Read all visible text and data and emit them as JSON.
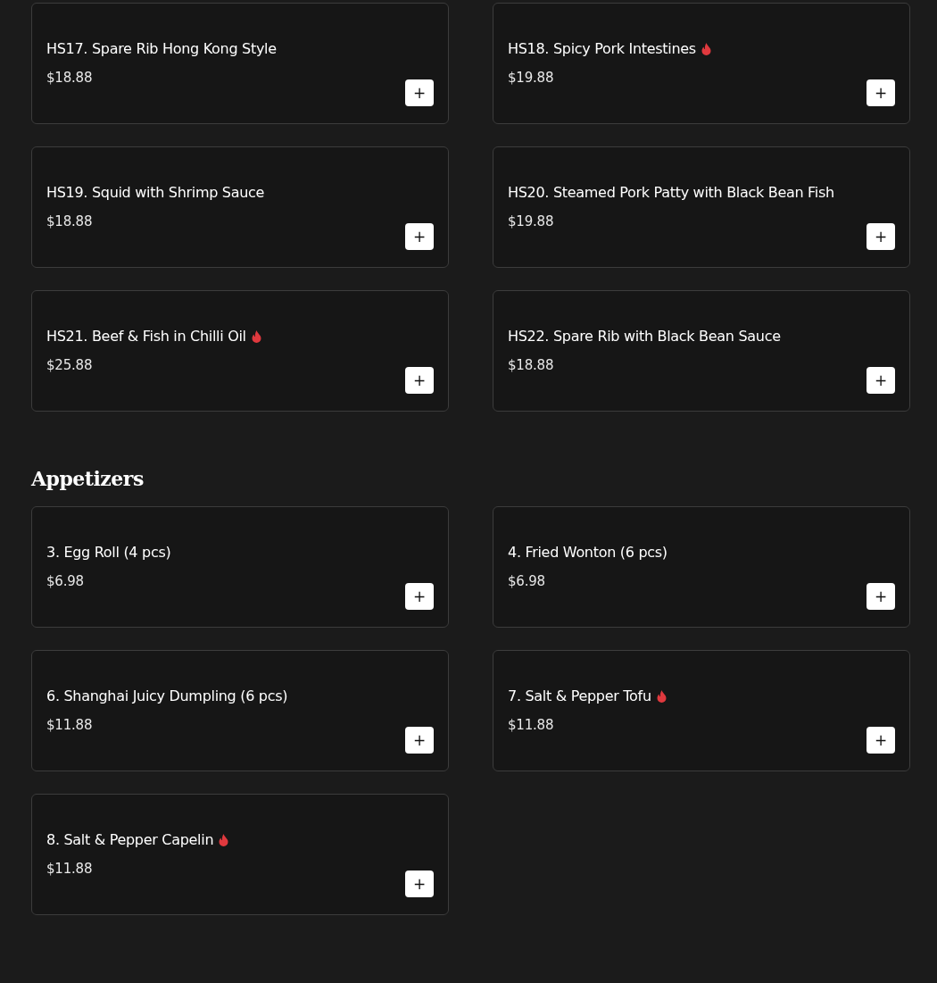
{
  "sections": [
    {
      "items": [
        {
          "name": "HS17. Spare Rib Hong Kong Style",
          "price": "$18.88",
          "spicy": false,
          "add_label": "+"
        },
        {
          "name": "HS18. Spicy Pork Intestines",
          "price": "$19.88",
          "spicy": true,
          "add_label": "+"
        },
        {
          "name": "HS19. Squid with Shrimp Sauce",
          "price": "$18.88",
          "spicy": false,
          "add_label": "+"
        },
        {
          "name": "HS20. Steamed Pork Patty with Black Bean Fish",
          "price": "$19.88",
          "spicy": false,
          "add_label": "+"
        },
        {
          "name": "HS21. Beef & Fish in Chilli Oil",
          "price": "$25.88",
          "spicy": true,
          "add_label": "+"
        },
        {
          "name": "HS22. Spare Rib with Black Bean Sauce",
          "price": "$18.88",
          "spicy": false,
          "add_label": "+"
        }
      ]
    },
    {
      "heading": "Appetizers",
      "items": [
        {
          "name": "3. Egg Roll (4 pcs)",
          "price": "$6.98",
          "spicy": false,
          "add_label": "+"
        },
        {
          "name": "4. Fried Wonton (6 pcs)",
          "price": "$6.98",
          "spicy": false,
          "add_label": "+"
        },
        {
          "name": "6. Shanghai Juicy Dumpling (6 pcs)",
          "price": "$11.88",
          "spicy": false,
          "add_label": "+"
        },
        {
          "name": "7. Salt & Pepper Tofu",
          "price": "$11.88",
          "spicy": true,
          "add_label": "+"
        },
        {
          "name": "8. Salt & Pepper Capelin",
          "price": "$11.88",
          "spicy": true,
          "add_label": "+"
        }
      ]
    }
  ]
}
